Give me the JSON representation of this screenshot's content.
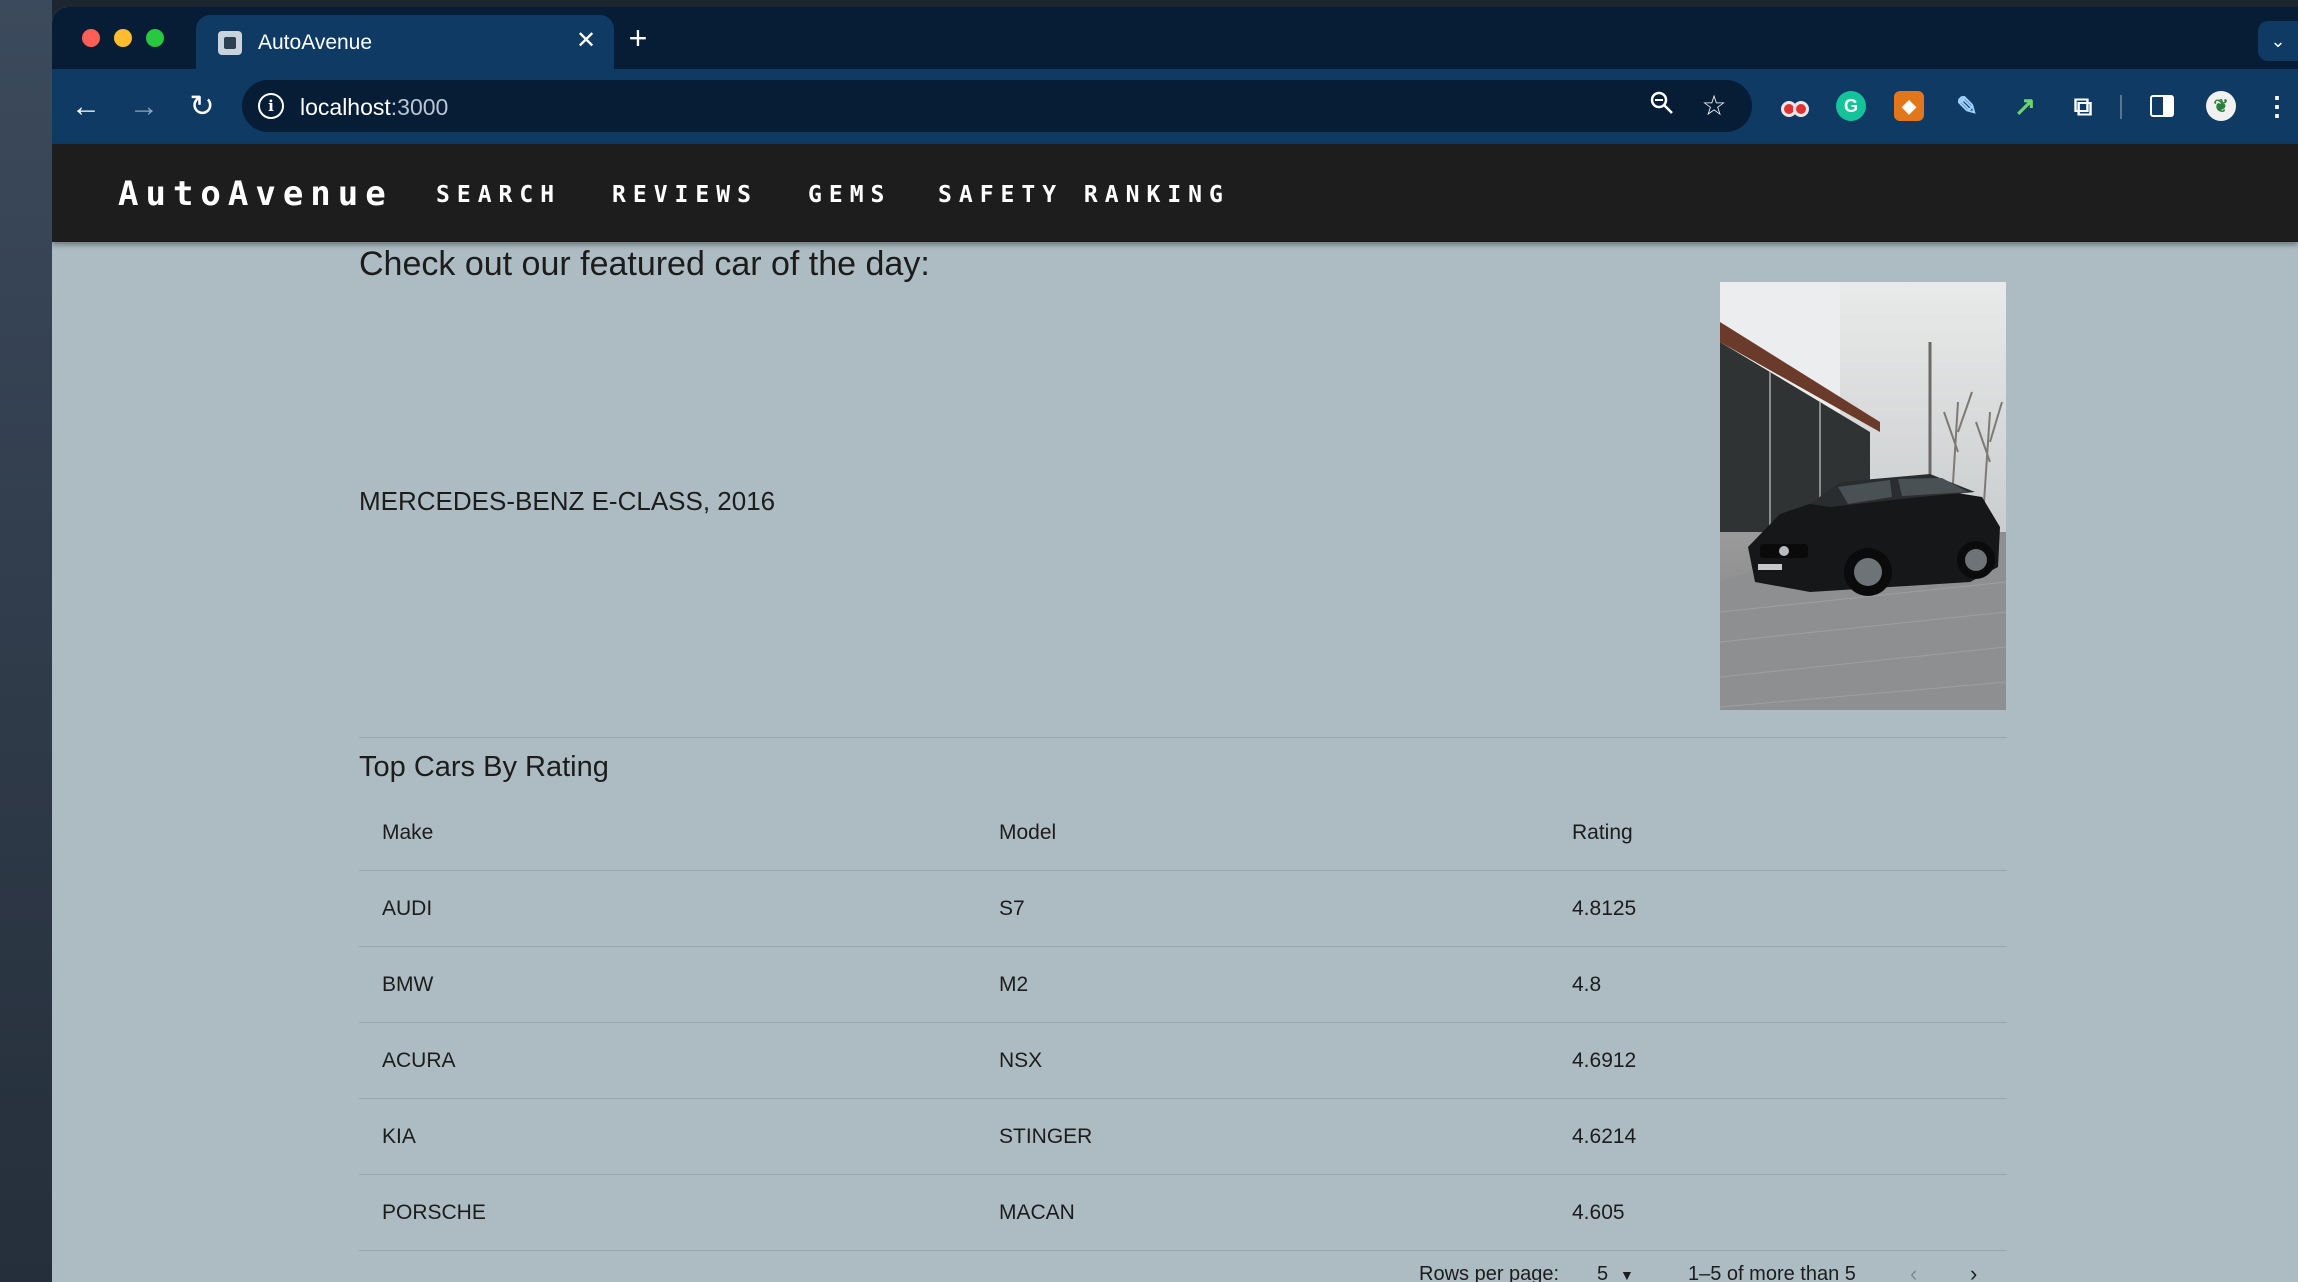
{
  "browser": {
    "tab_title": "AutoAvenue",
    "tab_close": "✕",
    "new_tab": "+",
    "url_host": "localhost",
    "url_port": ":3000"
  },
  "site": {
    "brand": "AutoAvenue",
    "nav": [
      "SEARCH",
      "REVIEWS",
      "GEMS",
      "SAFETY RANKING"
    ]
  },
  "featured": {
    "heading": "Check out our featured car of the day:",
    "car": "MERCEDES-BENZ E-CLASS, 2016"
  },
  "top_cars": {
    "title": "Top Cars By Rating",
    "columns": [
      "Make",
      "Model",
      "Rating"
    ],
    "rows": [
      [
        "AUDI",
        "S7",
        "4.8125"
      ],
      [
        "BMW",
        "M2",
        "4.8"
      ],
      [
        "ACURA",
        "NSX",
        "4.6912"
      ],
      [
        "KIA",
        "STINGER",
        "4.6214"
      ],
      [
        "PORSCHE",
        "MACAN",
        "4.605"
      ]
    ]
  },
  "pagination": {
    "rows_per_page_label": "Rows per page:",
    "rows_per_page_value": "5",
    "range": "1–5 of more than 5"
  }
}
